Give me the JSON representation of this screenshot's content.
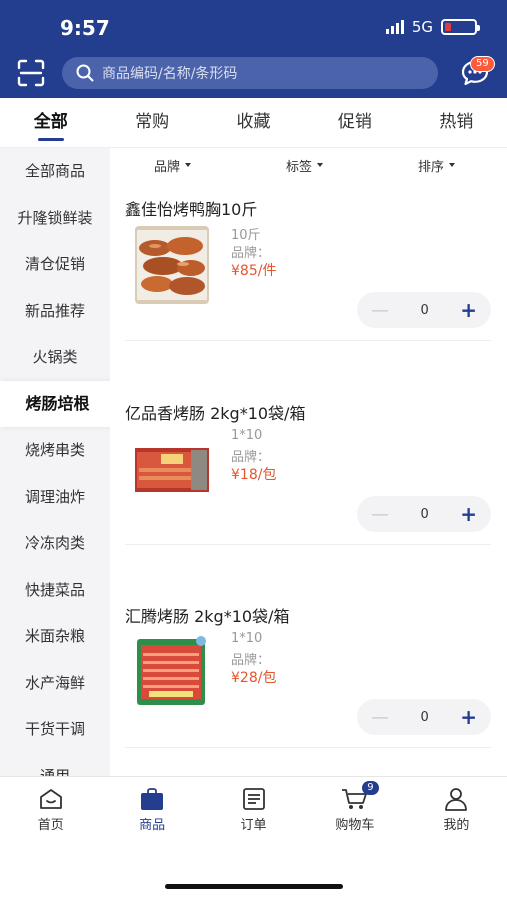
{
  "status": {
    "time": "9:57",
    "network": "5G"
  },
  "search": {
    "placeholder": "商品编码/名称/条形码"
  },
  "header": {
    "message_count": "59"
  },
  "tabs": [
    {
      "label": "全部"
    },
    {
      "label": "常购"
    },
    {
      "label": "收藏"
    },
    {
      "label": "促销"
    },
    {
      "label": "热销"
    }
  ],
  "sidebar": {
    "items": [
      {
        "label": "全部商品"
      },
      {
        "label": "升隆锁鲜装"
      },
      {
        "label": "清仓促销"
      },
      {
        "label": "新品推荐"
      },
      {
        "label": "火锅类"
      },
      {
        "label": "烤肠培根"
      },
      {
        "label": "烧烤串类"
      },
      {
        "label": "调理油炸"
      },
      {
        "label": "冷冻肉类"
      },
      {
        "label": "快捷菜品"
      },
      {
        "label": "米面杂粮"
      },
      {
        "label": "水产海鲜"
      },
      {
        "label": "干货干调"
      },
      {
        "label": "通用"
      }
    ]
  },
  "filters": {
    "brand": "品牌",
    "tag": "标签",
    "sort": "排序"
  },
  "products": [
    {
      "name": "鑫佳怡烤鸭胸10斤",
      "spec": "10斤",
      "brand_label": "品牌：",
      "price": "¥85",
      "unit": "/件",
      "qty": "0"
    },
    {
      "name": "亿品香烤肠 2kg*10袋/箱",
      "spec": "1*10",
      "brand_label": "品牌：",
      "price": "¥18",
      "unit": "/包",
      "qty": "0"
    },
    {
      "name": "汇腾烤肠 2kg*10袋/箱",
      "spec": "1*10",
      "brand_label": "品牌：",
      "price": "¥28",
      "unit": "/包",
      "qty": "0"
    }
  ],
  "bottom_nav": [
    {
      "label": "首页"
    },
    {
      "label": "商品"
    },
    {
      "label": "订单"
    },
    {
      "label": "购物车"
    },
    {
      "label": "我的"
    }
  ],
  "cart_count": "9",
  "colors": {
    "brand": "#233d8f",
    "price": "#e4572e",
    "badge": "#ff5a3c"
  }
}
